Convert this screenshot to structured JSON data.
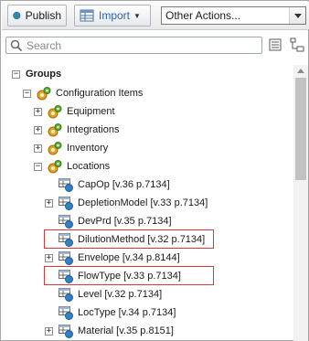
{
  "toolbar": {
    "publish_label": "Publish",
    "import_label": "Import",
    "other_actions": "Other Actions..."
  },
  "search": {
    "placeholder": "Search"
  },
  "colors": {
    "highlight_border": "#d9383a",
    "import_text": "#2b62a8"
  },
  "tree": {
    "groups": "Groups",
    "configuration_items": "Configuration Items",
    "children": [
      "Equipment",
      "Integrations",
      "Inventory",
      "Locations"
    ],
    "locations": [
      "CapOp [v.36 p.7134]",
      "DepletionModel [v.33 p.7134]",
      "DevPrd [v.35 p.7134]",
      "DilutionMethod [v.32 p.7134]",
      "Envelope [v.34 p.8144]",
      "FlowType [v.33 p.7134]",
      "Level [v.32 p.7134]",
      "LocType [v.34 p.7134]",
      "Material [v.35 p.8151]"
    ]
  },
  "icons": {
    "publish": "globe-icon",
    "import": "import-table-icon",
    "search": "search-icon",
    "collapse": "collapse-all-icon",
    "locate": "tree-link-icon",
    "folder": "config-folder-icon",
    "table": "table-globe-icon"
  }
}
